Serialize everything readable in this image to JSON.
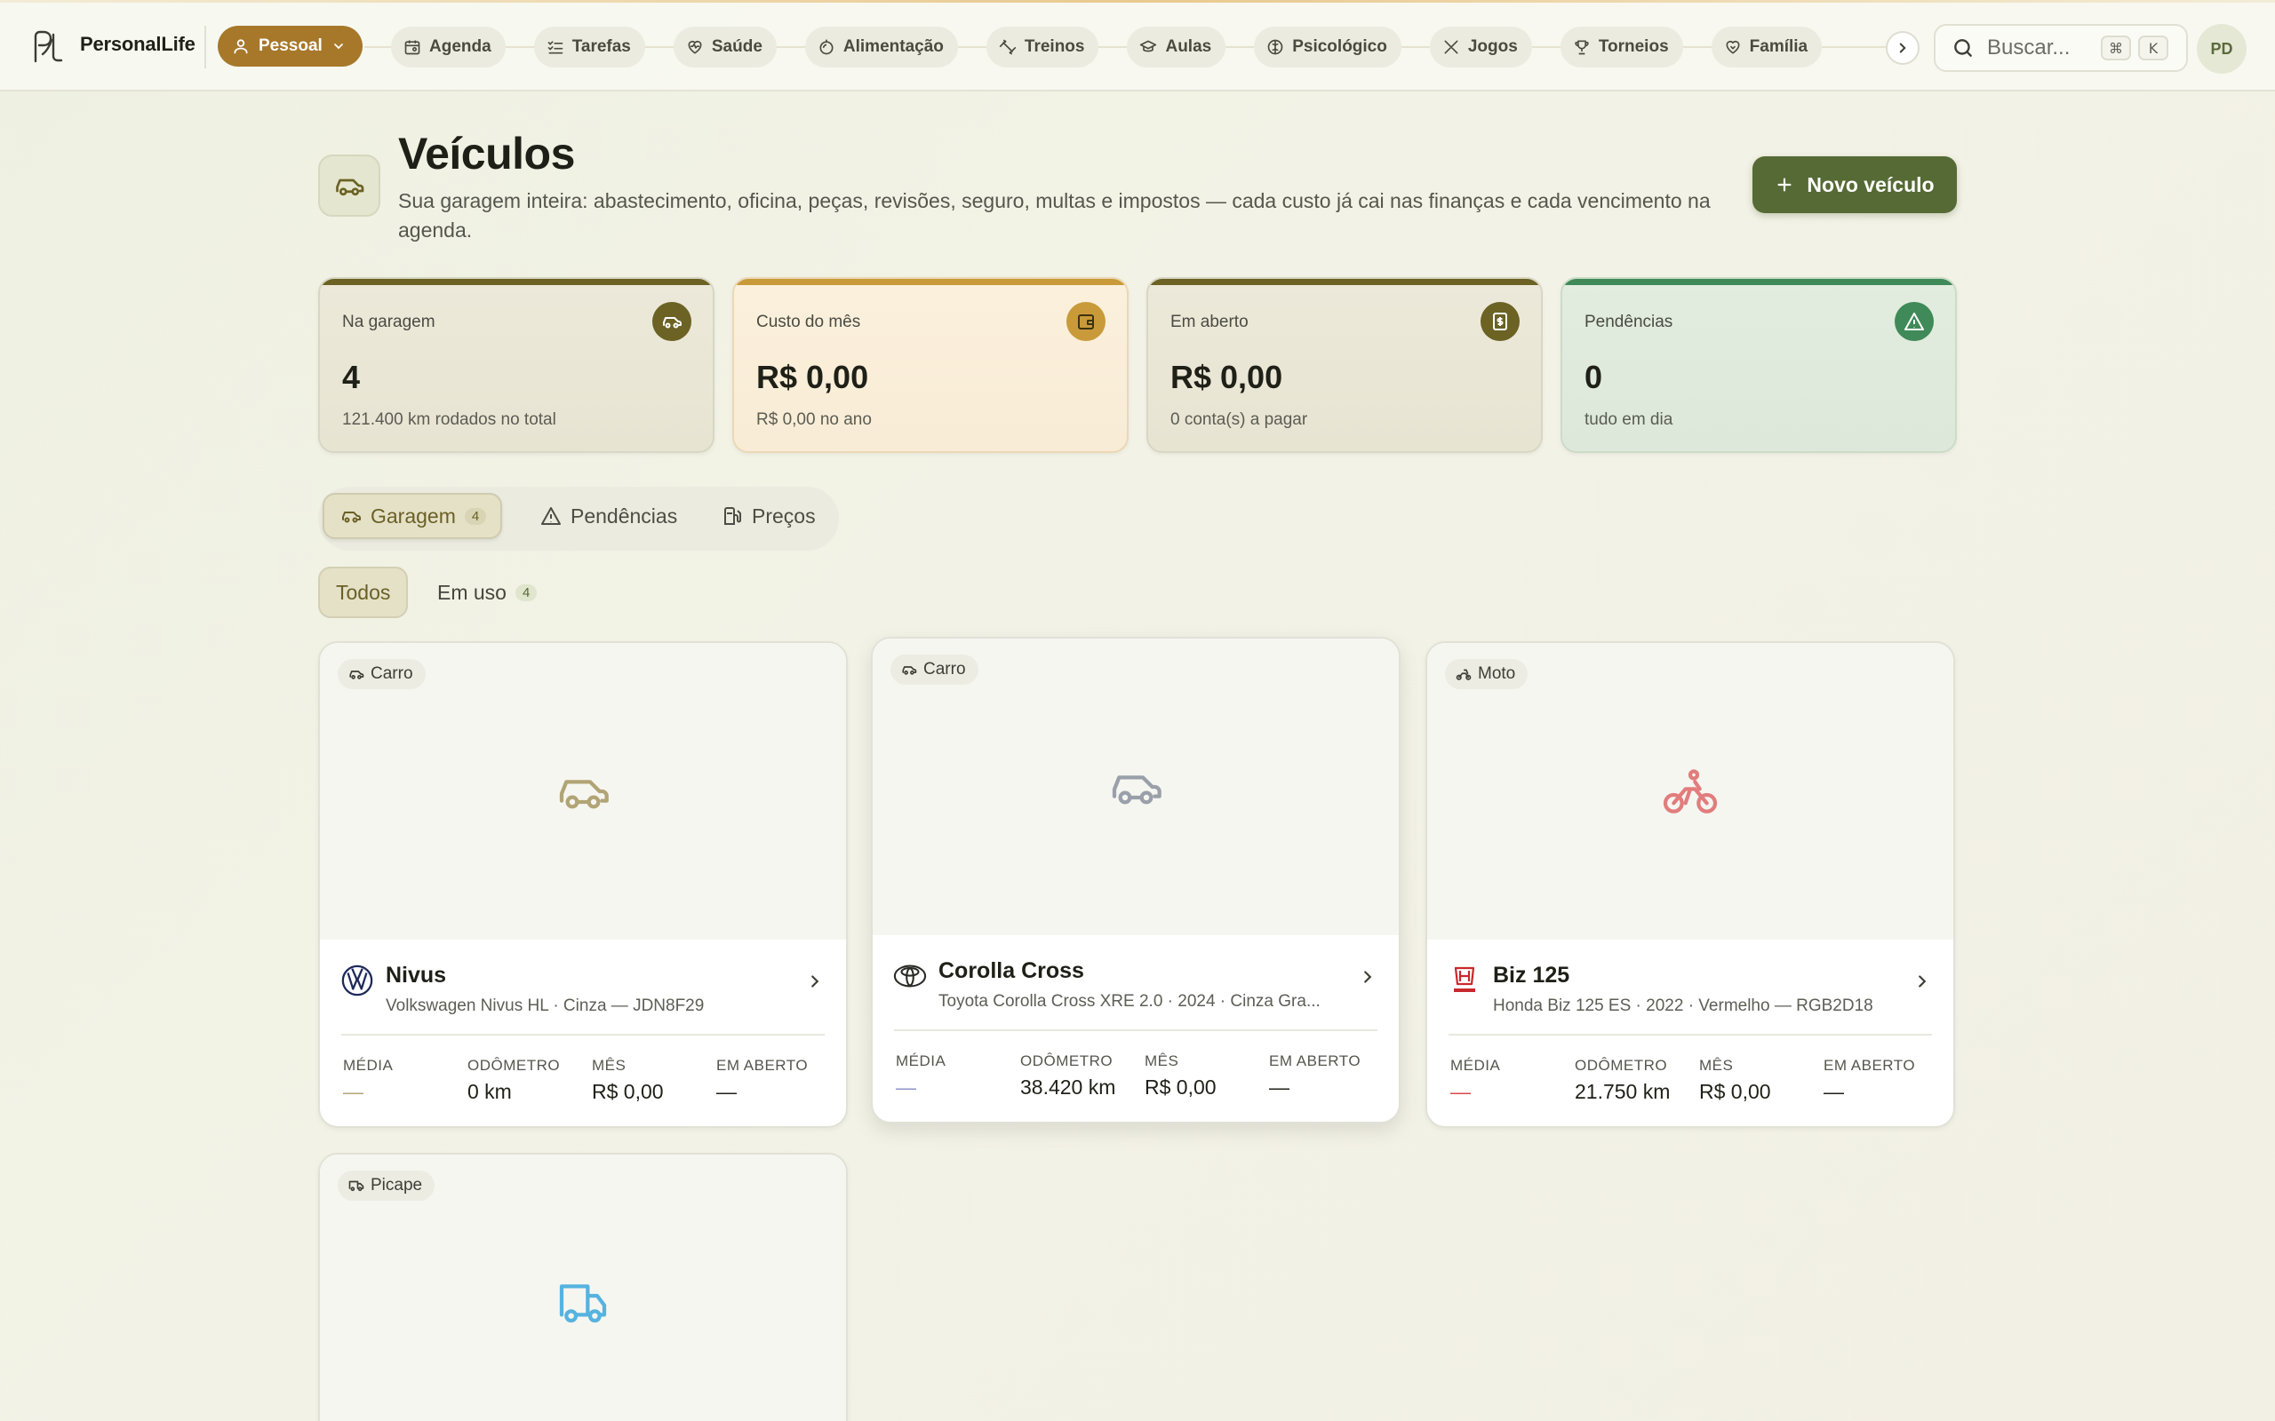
{
  "app": {
    "brand": "PersonalLife",
    "profile_label": "Pessoal",
    "avatar_initials": "PD"
  },
  "nav": {
    "items": [
      {
        "label": "Agenda",
        "icon": "calendar-icon"
      },
      {
        "label": "Tarefas",
        "icon": "checklist-icon"
      },
      {
        "label": "Saúde",
        "icon": "heart-pulse-icon"
      },
      {
        "label": "Alimentação",
        "icon": "apple-icon"
      },
      {
        "label": "Treinos",
        "icon": "dumbbell-icon"
      },
      {
        "label": "Aulas",
        "icon": "graduation-cap-icon"
      },
      {
        "label": "Psicológico",
        "icon": "brain-icon"
      },
      {
        "label": "Jogos",
        "icon": "swords-icon"
      },
      {
        "label": "Torneios",
        "icon": "trophy-icon"
      },
      {
        "label": "Família",
        "icon": "heart-handshake-icon"
      }
    ]
  },
  "search": {
    "placeholder": "Buscar...",
    "shortcut_mod": "⌘",
    "shortcut_key": "K"
  },
  "header": {
    "title": "Veículos",
    "subtitle": "Sua garagem inteira: abastecimento, oficina, peças, revisões, seguro, multas e impostos — cada custo já cai nas finanças e cada vencimento na agenda.",
    "new_button": "Novo veículo"
  },
  "stats": [
    {
      "label": "Na garagem",
      "value": "4",
      "note": "121.400 km rodados no total",
      "accent": "#6b6224",
      "icon": "car-icon"
    },
    {
      "label": "Custo do mês",
      "value": "R$ 0,00",
      "note": "R$ 0,00 no ano",
      "accent": "#c99a3a",
      "icon": "wallet-icon"
    },
    {
      "label": "Em aberto",
      "value": "R$ 0,00",
      "note": "0 conta(s) a pagar",
      "accent": "#6b6224",
      "icon": "receipt-icon"
    },
    {
      "label": "Pendências",
      "value": "0",
      "note": "tudo em dia",
      "accent": "#3f8a58",
      "icon": "warning-icon"
    }
  ],
  "tabs": [
    {
      "label": "Garagem",
      "count": "4"
    },
    {
      "label": "Pendências"
    },
    {
      "label": "Preços"
    }
  ],
  "filters": [
    {
      "label": "Todos"
    },
    {
      "label": "Em uso",
      "count": "4"
    }
  ],
  "stat_labels": {
    "media": "MÉDIA",
    "odometro": "ODÔMETRO",
    "mes": "MÊS",
    "em_aberto": "EM ABERTO"
  },
  "vehicles": [
    {
      "type": "Carro",
      "name": "Nivus",
      "desc": "Volkswagen Nivus HL · Cinza — JDN8F29",
      "media": "—",
      "odometro": "0 km",
      "mes": "R$ 0,00",
      "em_aberto": "—",
      "color": "#b1a475",
      "brand_icon": "volkswagen-logo-icon"
    },
    {
      "type": "Carro",
      "name": "Corolla Cross",
      "desc": "Toyota Corolla Cross XRE 2.0 · 2024 · Cinza Gra...",
      "media": "—",
      "odometro": "38.420 km",
      "mes": "R$ 0,00",
      "em_aberto": "—",
      "color": "#9aa0aa",
      "brand_icon": "toyota-logo-icon"
    },
    {
      "type": "Moto",
      "name": "Biz 125",
      "desc": "Honda Biz 125 ES · 2022 · Vermelho — RGB2D18",
      "media": "—",
      "odometro": "21.750 km",
      "mes": "R$ 0,00",
      "em_aberto": "—",
      "color": "#e27d7d",
      "brand_icon": "honda-logo-icon"
    },
    {
      "type": "Picape",
      "color": "#56b3e0"
    }
  ]
}
